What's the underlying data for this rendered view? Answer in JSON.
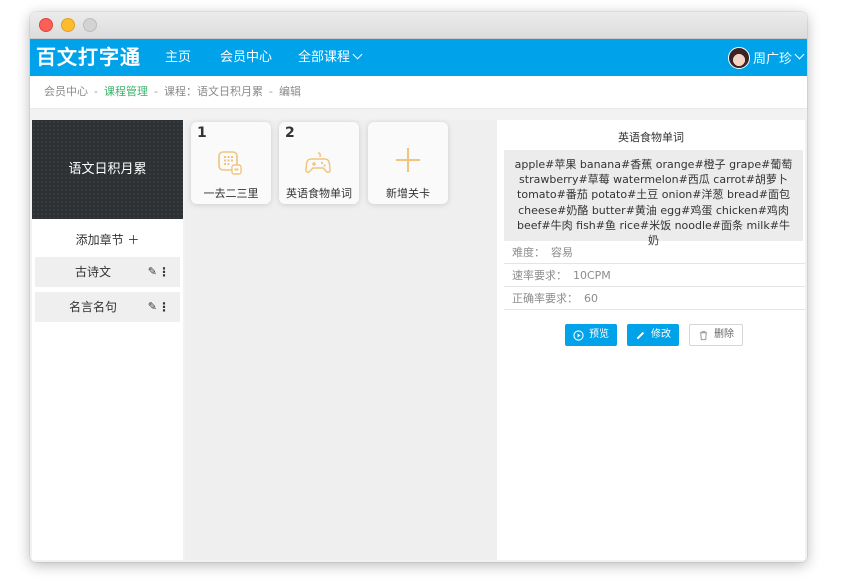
{
  "nav": {
    "brand": "百文打字通",
    "items": [
      "主页",
      "会员中心",
      "全部课程"
    ],
    "user": "周广珍"
  },
  "breadcrumb": [
    "会员中心",
    "课程管理",
    "课程：语文日积月累",
    "编辑"
  ],
  "course": {
    "cover_title": "语文日积月累",
    "add_chapter": "添加章节 ＋",
    "chapters": [
      "古诗文",
      "名言名句"
    ]
  },
  "cards": [
    {
      "num": "1",
      "name": "一去二三里",
      "icon": "keypad-icon"
    },
    {
      "num": "2",
      "name": "英语食物单词",
      "icon": "gamepad-icon"
    },
    {
      "num": "",
      "name": "新增关卡",
      "icon": "plus-icon"
    }
  ],
  "detail": {
    "title": "英语食物单词",
    "content": "apple#苹果 banana#香蕉 orange#橙子 grape#葡萄 strawberry#草莓 watermelon#西瓜 carrot#胡萝卜 tomato#番茄 potato#土豆 onion#洋葱 bread#面包 cheese#奶酪 butter#黄油 egg#鸡蛋 chicken#鸡肉 beef#牛肉 fish#鱼 rice#米饭 noodle#面条 milk#牛奶",
    "fields": [
      {
        "label": "难度：",
        "value": "容易"
      },
      {
        "label": "速率要求：",
        "value": "10CPM"
      },
      {
        "label": "正确率要求：",
        "value": "60"
      }
    ],
    "buttons": {
      "preview": "预览",
      "edit": "修改",
      "delete": "删除"
    }
  },
  "colors": {
    "accent": "#00a2ea",
    "active_link": "#3bb36b",
    "card_icon": "#f1c47d"
  }
}
